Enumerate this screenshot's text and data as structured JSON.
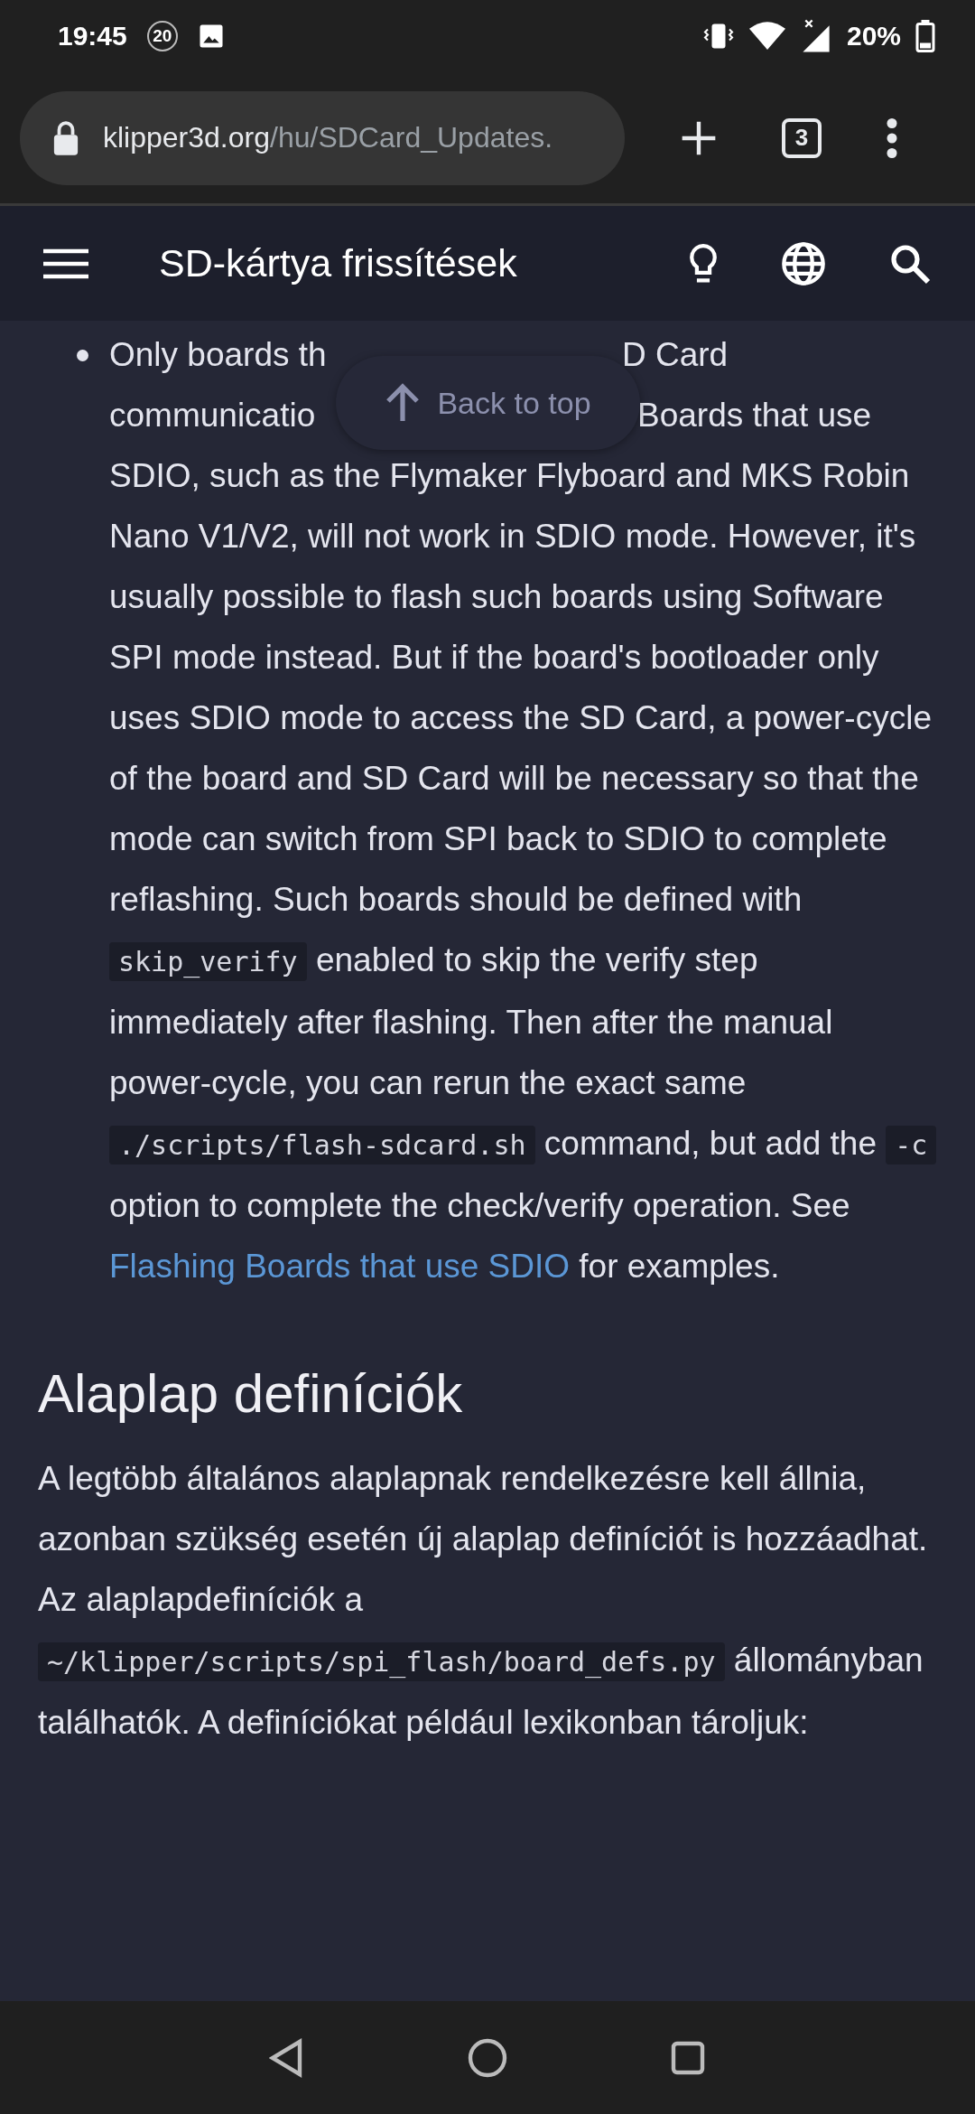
{
  "status_bar": {
    "time": "19:45",
    "notification_count": "20",
    "battery": "20%"
  },
  "browser": {
    "url_host": "klipper3d.org",
    "url_path": "/hu/SDCard_Updates.",
    "tab_count": "3"
  },
  "site_header": {
    "title": "SD-kártya frissítések"
  },
  "back_to_top": {
    "label": "Back to top"
  },
  "list_item": {
    "line_1_left": "Only boards th",
    "line_1_right": "D Card",
    "line_2_left": "communicatio",
    "rest": [
      {
        "kind": "text",
        "text": "Boards that use SDIO, such as the Flymaker Flyboard and MKS Robin Nano V1/V2, will not work in SDIO mode. However, it's usually possible to flash such boards using Software SPI mode instead. But if the board's bootloader only uses SDIO mode to access the SD Card, a power-cycle of the board and SD Card will be necessary so that the mode can switch from SPI back to SDIO to complete reflashing. Such boards should be defined with "
      },
      {
        "kind": "code",
        "text": "skip_verify"
      },
      {
        "kind": "text",
        "text": " enabled to skip the verify step immediately after flashing. Then after the manual power-cycle, you can rerun the exact same "
      },
      {
        "kind": "code",
        "text": "./scripts/flash-sdcard.sh"
      },
      {
        "kind": "text",
        "text": " command, but add the "
      },
      {
        "kind": "code",
        "text": "-c"
      },
      {
        "kind": "text",
        "text": " option to complete the check/verify operation. See "
      },
      {
        "kind": "link",
        "text": "Flashing Boards that use SDIO"
      },
      {
        "kind": "text",
        "text": " for examples."
      }
    ]
  },
  "section": {
    "heading": "Alaplap definíciók",
    "paragraph": [
      {
        "kind": "text",
        "text": "A legtöbb általános alaplapnak rendelkezésre kell állnia, azonban szükség esetén új alaplap definíciót is hozzáadhat. Az alaplapdefiníciók a "
      },
      {
        "kind": "code",
        "text": "~/klipper/scripts/spi_flash/board_defs.py"
      },
      {
        "kind": "text",
        "text": " állományban találhatók. A definíciókat például lexikonban tároljuk:"
      }
    ]
  }
}
